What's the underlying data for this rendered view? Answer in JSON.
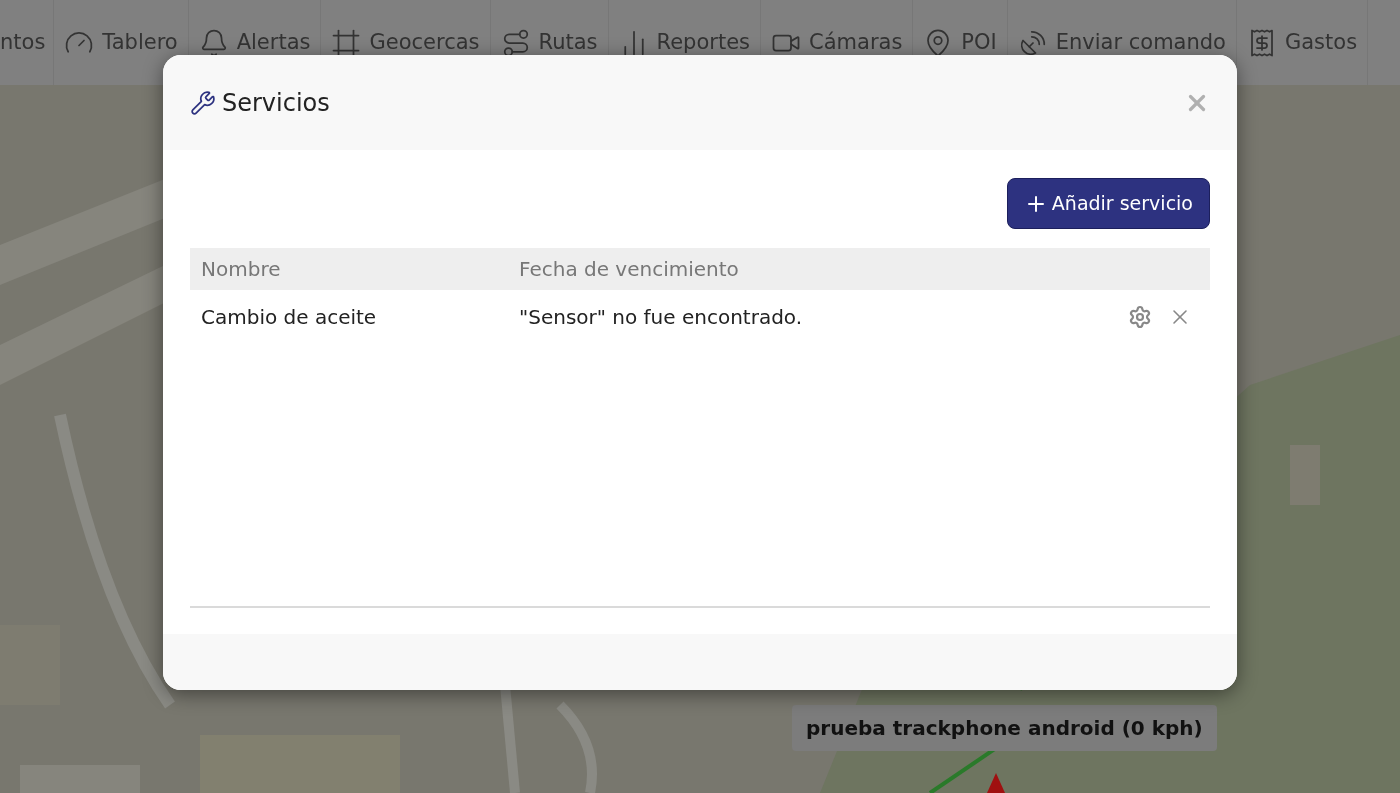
{
  "nav": {
    "items": [
      {
        "label": "ntos",
        "kind": "plain"
      },
      {
        "label": "Tablero",
        "kind": "gauge"
      },
      {
        "label": "Alertas",
        "kind": "bell"
      },
      {
        "label": "Geocercas",
        "kind": "frame"
      },
      {
        "label": "Rutas",
        "kind": "route"
      },
      {
        "label": "Reportes",
        "kind": "chart"
      },
      {
        "label": "Cámaras",
        "kind": "video"
      },
      {
        "label": "POI",
        "kind": "pin"
      },
      {
        "label": "Enviar comando",
        "kind": "dish"
      },
      {
        "label": "Gastos",
        "kind": "receipt"
      }
    ]
  },
  "map": {
    "kind": "picture",
    "marker_label": "prueba trackphone android (0 kph)"
  },
  "modal": {
    "title": "Servicios",
    "add_button": "Añadir servicio",
    "table": {
      "columns": [
        "Nombre",
        "Fecha de vencimiento"
      ],
      "rows": [
        {
          "cells": [
            "Cambio de aceite",
            "\"Sensor\" no fue encontrado."
          ]
        }
      ]
    }
  }
}
